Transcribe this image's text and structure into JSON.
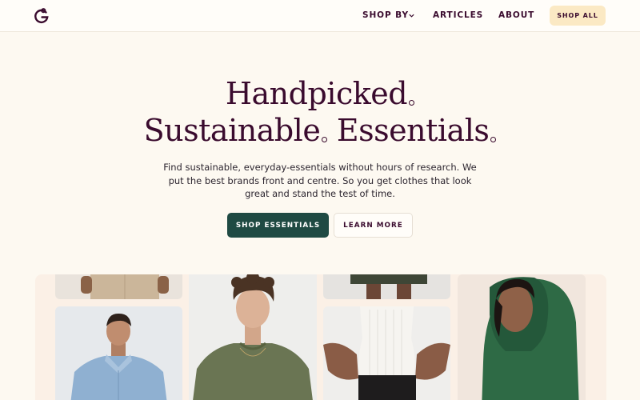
{
  "nav": {
    "logo": "brand-logo",
    "links": [
      {
        "label": "SHOP BY",
        "has_dropdown": true
      },
      {
        "label": "ARTICLES"
      },
      {
        "label": "ABOUT"
      }
    ],
    "cta_label": "SHOP ALL"
  },
  "hero": {
    "headline_line1": "Handpicked",
    "headline_line2_a": "Sustainable",
    "headline_line2_b": "Essentials",
    "subtitle": "Find sustainable, everyday-essentials without hours of research. We put the best brands front and centre. So you get clothes that look great and stand the test of time.",
    "primary_cta": "SHOP ESSENTIALS",
    "secondary_cta": "LEARN MORE"
  },
  "gallery": {
    "tiles": [
      {
        "subject": "model-khaki-trousers",
        "image_description": "legs in khaki chinos"
      },
      {
        "subject": "model-blue-oxford-shirt",
        "image_description": "man in light blue button-down shirt"
      },
      {
        "subject": "model-olive-tshirt",
        "image_description": "man with curly hair in olive t-shirt"
      },
      {
        "subject": "model-denim-shorts",
        "image_description": "legs in dark shorts"
      },
      {
        "subject": "model-white-ribbed-tank",
        "image_description": "woman in white ribbed tank top"
      },
      {
        "subject": "model-green-hoodie",
        "image_description": "woman in green hoodie"
      }
    ]
  },
  "colors": {
    "background": "#fdf9f1",
    "headline": "#3a0b2e",
    "primary_button": "#1f4a43",
    "shop_all_button": "#fbe9c4"
  }
}
